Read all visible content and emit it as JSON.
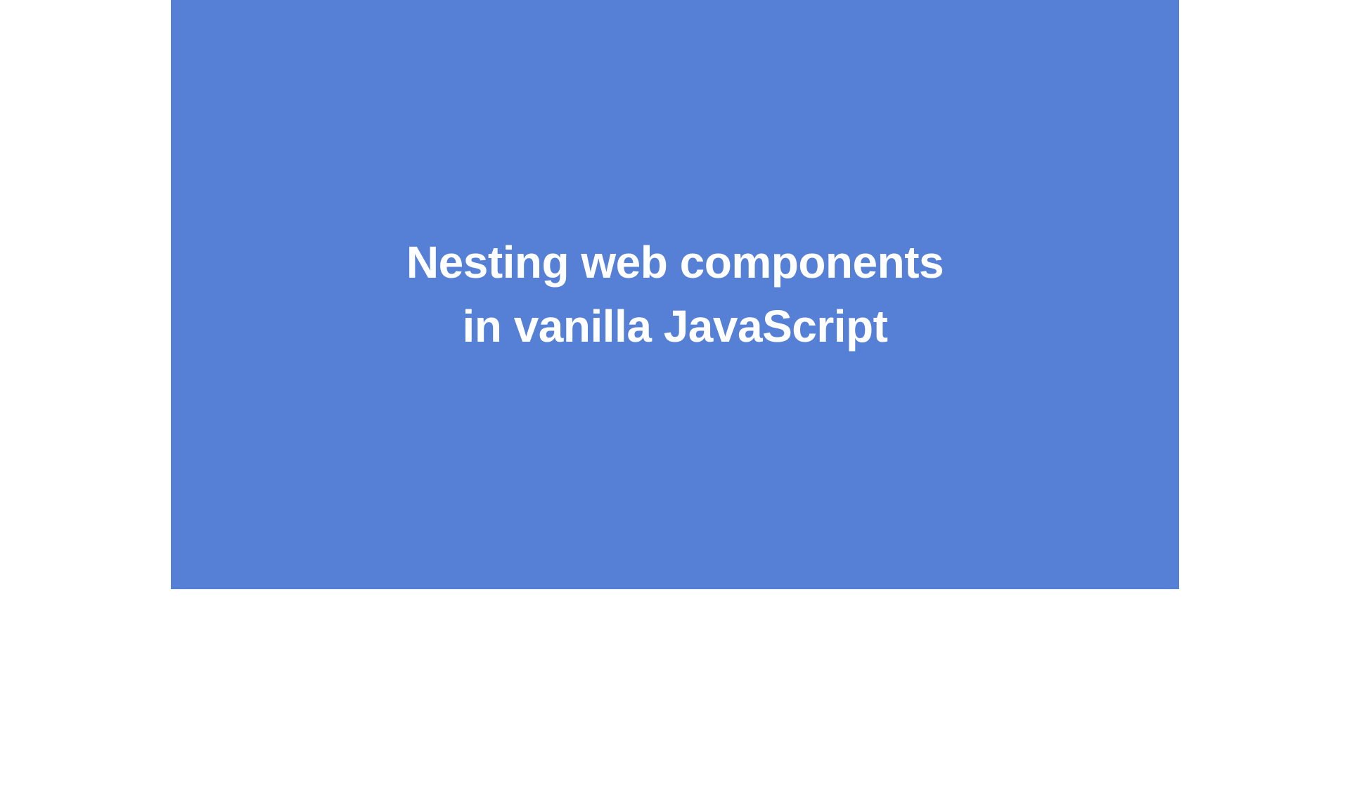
{
  "slide": {
    "title_line1": "Nesting web components",
    "title_line2": "in vanilla JavaScript"
  }
}
